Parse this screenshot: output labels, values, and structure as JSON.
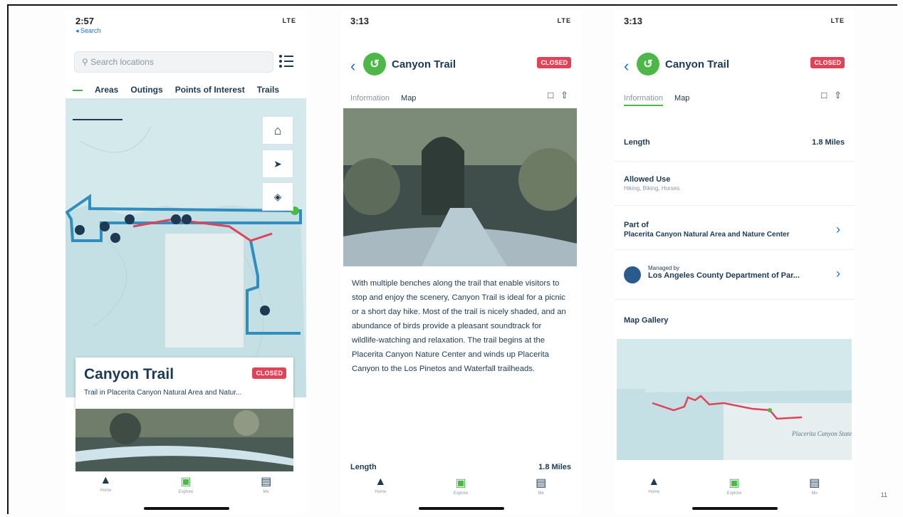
{
  "colors": {
    "accent": "#4cb848",
    "closed": "#e04358",
    "text": "#1d3a52",
    "link": "#1d6fd6",
    "water": "#cfe6ea"
  },
  "screen1": {
    "time": "2:57",
    "back": "◂ Search",
    "signal": "LTE",
    "search_placeholder": "Search locations",
    "categories": [
      "Areas",
      "Outings",
      "Points of Interest",
      "Trails"
    ],
    "card": {
      "title": "Canyon Trail",
      "badge": "CLOSED",
      "subtitle": "Trail in Placerita Canyon Natural Area and Natur..."
    },
    "tabs": [
      "Home",
      "Explore",
      "Me"
    ]
  },
  "screen2": {
    "time": "3:13",
    "signal": "LTE",
    "title": "Canyon Trail",
    "badge": "CLOSED",
    "tab_info": "Information",
    "tab_map": "Map",
    "description": "With multiple benches along the trail that enable visitors to stop and enjoy the scenery, Canyon Trail is ideal for a picnic or a short day hike. Most of the trail is nicely shaded, and an abundance of birds provide a pleasant soundtrack for wildlife-watching and relaxation. The trail begins at the Placerita Canyon Nature Center and winds up Placerita Canyon to the Los Pinetos and Waterfall trailheads.",
    "length_label": "Length",
    "length_value": "1.8 Miles",
    "tabs": [
      "Home",
      "Explore",
      "Me"
    ]
  },
  "screen3": {
    "time": "3:13",
    "signal": "LTE",
    "title": "Canyon Trail",
    "badge": "CLOSED",
    "tab_info": "Information",
    "tab_map": "Map",
    "length_label": "Length",
    "length_value": "1.8 Miles",
    "allowed_label": "Allowed Use",
    "allowed_value": "Hiking, Biking, Horses",
    "partof_label": "Part of",
    "partof_value": "Placerita Canyon Natural Area and Nature Center",
    "managed_label": "Managed by",
    "managed_value": "Los Angeles County Department of Par...",
    "gallery_label": "Map Gallery",
    "map_place": "Placerita Canyon State Park",
    "tabs": [
      "Home",
      "Explore",
      "Me"
    ]
  },
  "page_number": "11"
}
